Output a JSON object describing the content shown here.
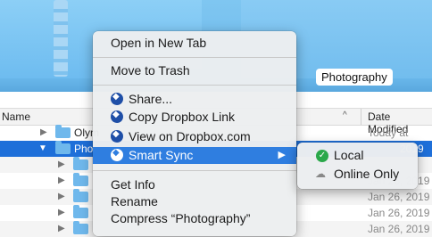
{
  "preview": {
    "folder_label": "Photography"
  },
  "columns": {
    "name": "Name",
    "sort_arrow": "^",
    "date": "Date Modified"
  },
  "rows": [
    {
      "name": "Olym",
      "date": "Today at 1:51",
      "expanded": false,
      "selected": false
    },
    {
      "name": "Pho",
      "date": "2019",
      "expanded": true,
      "selected": true
    },
    {
      "name": "",
      "date": "",
      "expanded": false,
      "selected": false
    },
    {
      "name": "",
      "date": "Jan 26, 2019",
      "expanded": false,
      "selected": false
    },
    {
      "name": "",
      "date": "Jan 26, 2019",
      "expanded": false,
      "selected": false
    },
    {
      "name": "",
      "date": "Jan 26, 2019",
      "expanded": false,
      "selected": false
    },
    {
      "name": "",
      "date": "Jan 26, 2019",
      "expanded": false,
      "selected": false
    }
  ],
  "context_menu": {
    "open_new_tab": "Open in New Tab",
    "move_to_trash": "Move to Trash",
    "share": "Share...",
    "copy_link": "Copy Dropbox Link",
    "view_on_dropbox": "View on Dropbox.com",
    "smart_sync": "Smart Sync",
    "get_info": "Get Info",
    "rename": "Rename",
    "compress": "Compress “Photography”"
  },
  "submenu": {
    "local": "Local",
    "online_only": "Online Only",
    "selected": "Local"
  },
  "colors": {
    "highlight": "#2f7ee0",
    "selection": "#1e6fd9",
    "dropbox": "#1f4fa7",
    "check": "#2aa84a"
  }
}
